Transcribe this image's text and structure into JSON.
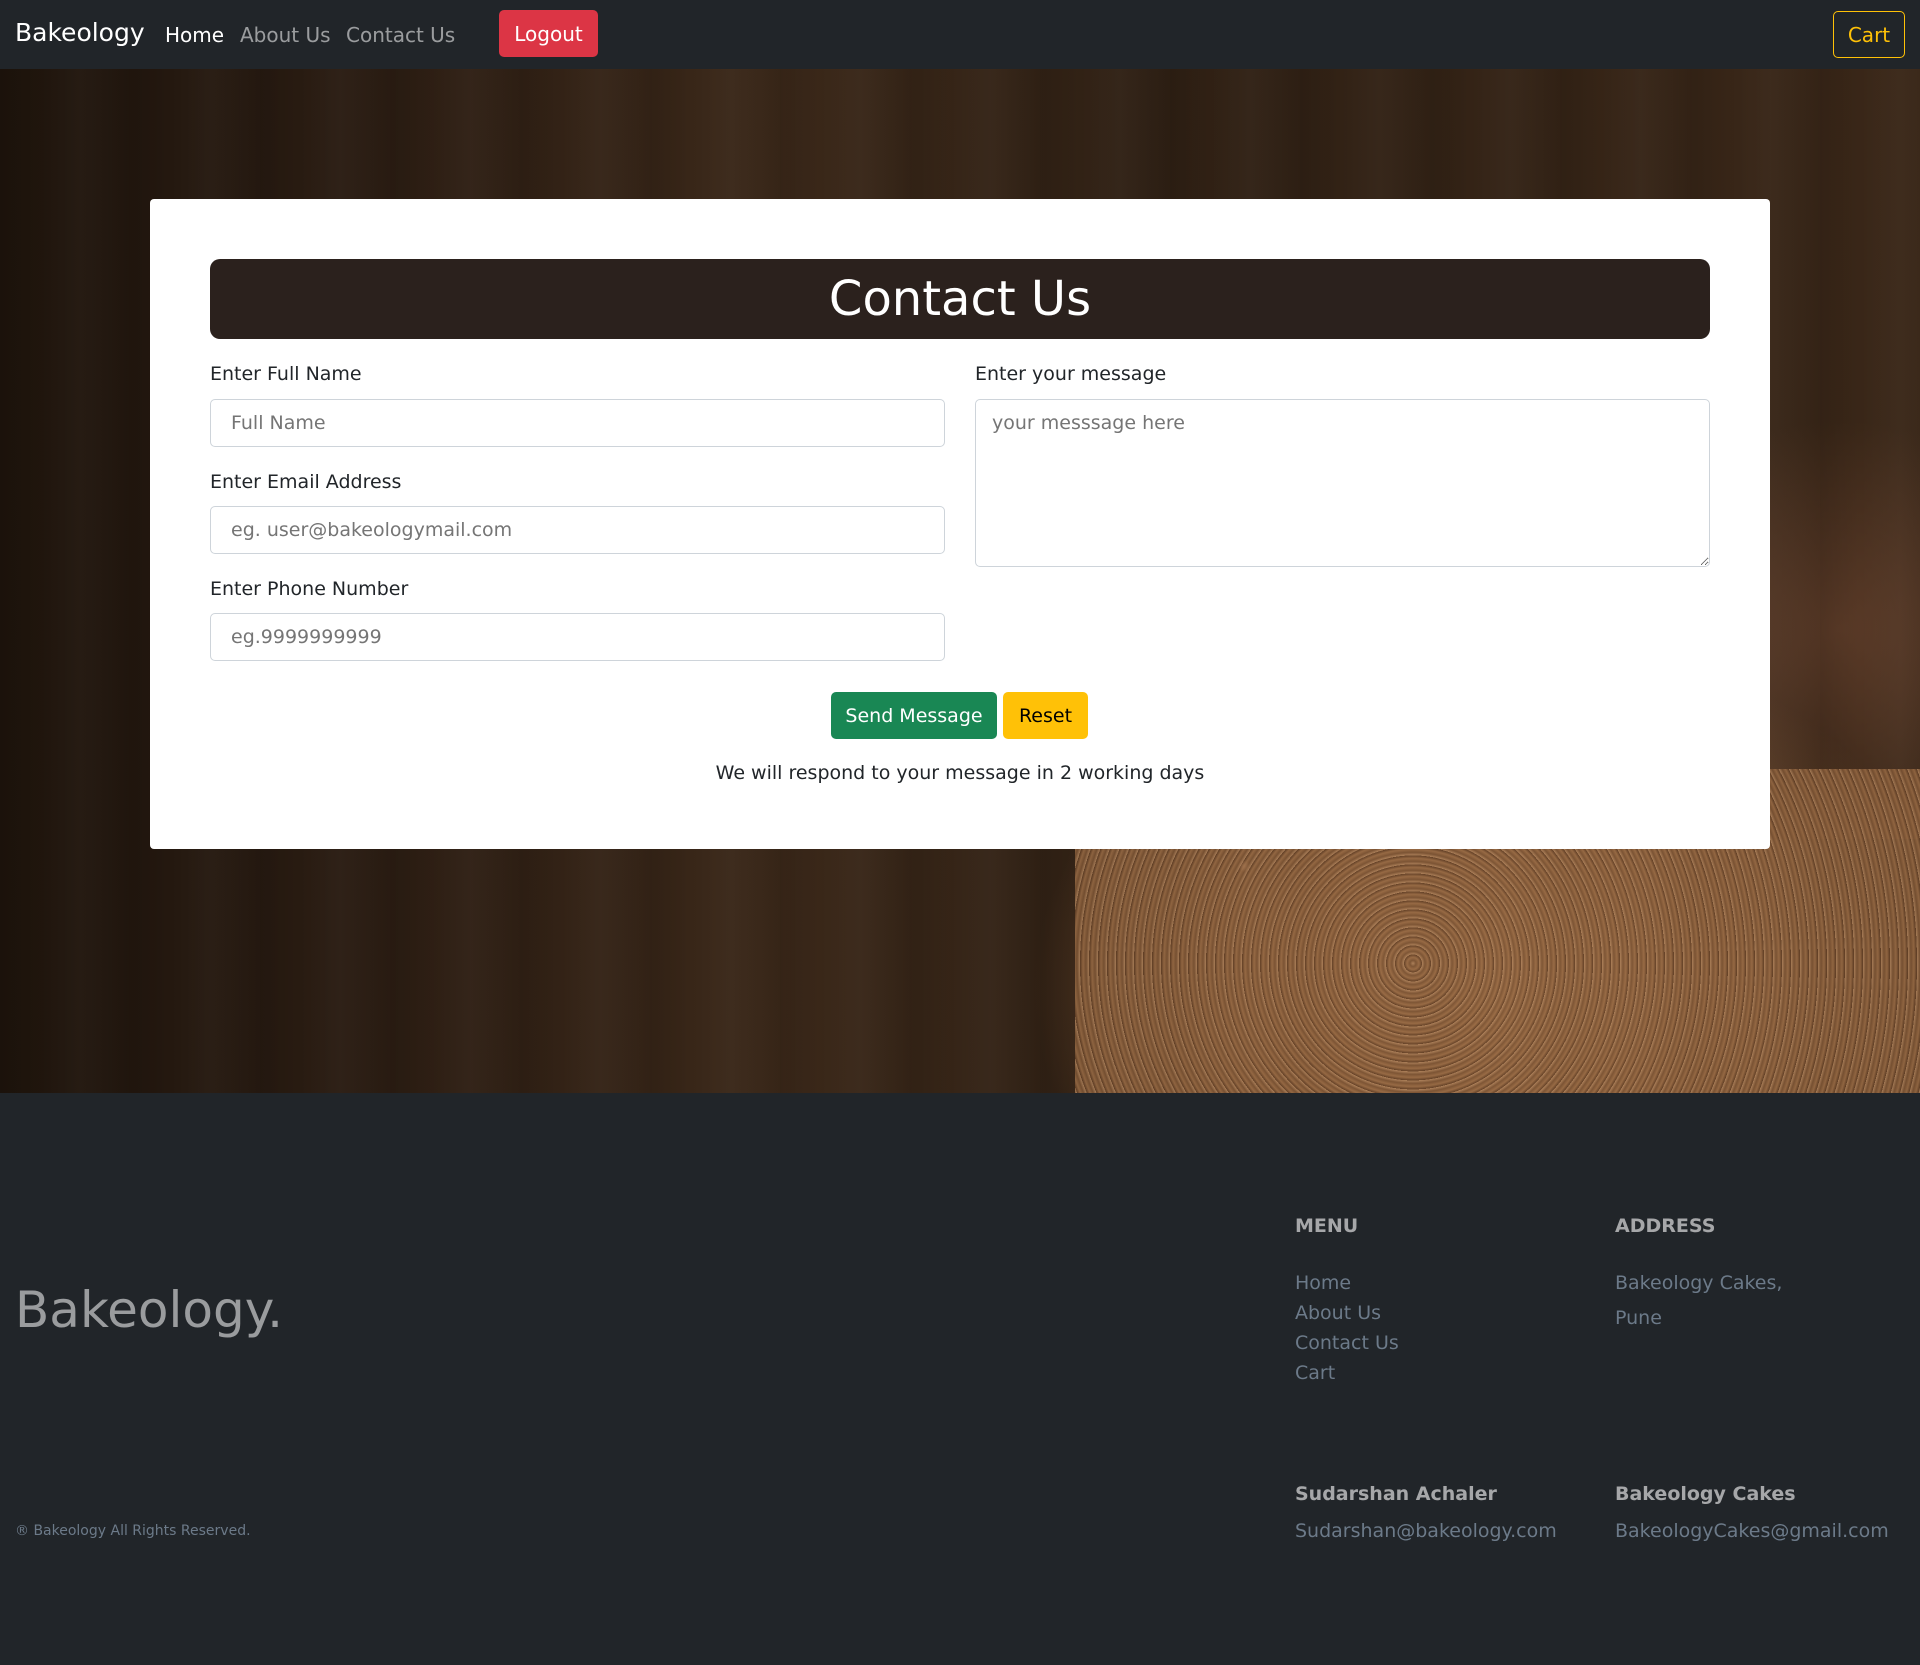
{
  "navbar": {
    "brand": "Bakeology",
    "links": [
      {
        "label": "Home"
      },
      {
        "label": "About Us"
      },
      {
        "label": "Contact Us"
      }
    ],
    "logout_label": "Logout",
    "cart_label": "Cart"
  },
  "contact_form": {
    "title": "Contact Us",
    "full_name_label": "Enter Full Name",
    "full_name_placeholder": "Full Name",
    "email_label": "Enter Email Address",
    "email_placeholder": "eg. user@bakeologymail.com",
    "phone_label": "Enter Phone Number",
    "phone_placeholder": "eg.9999999999",
    "message_label": "Enter your message",
    "message_placeholder": "your messsage here",
    "send_label": "Send Message",
    "reset_label": "Reset",
    "respond_note": "We will respond to your message in 2 working days"
  },
  "footer": {
    "brand": "Bakeology.",
    "menu_heading": "MENU",
    "menu_links": [
      "Home",
      "About Us",
      "Contact Us",
      "Cart"
    ],
    "address_heading": "ADDRESS",
    "address_lines": [
      "Bakeology Cakes,",
      "Pune"
    ],
    "contact1_name": "Sudarshan Achaler",
    "contact1_email": "Sudarshan@bakeology.com",
    "contact2_name": "Bakeology Cakes",
    "contact2_email": "BakeologyCakes@gmail.com",
    "copyright": "® Bakeology All Rights Reserved."
  },
  "colors": {
    "navbar_bg": "#212529",
    "logout": "#dc3545",
    "cart_outline": "#ffc107",
    "title_bar": "#2b211d",
    "send": "#198754",
    "reset": "#ffc107"
  }
}
